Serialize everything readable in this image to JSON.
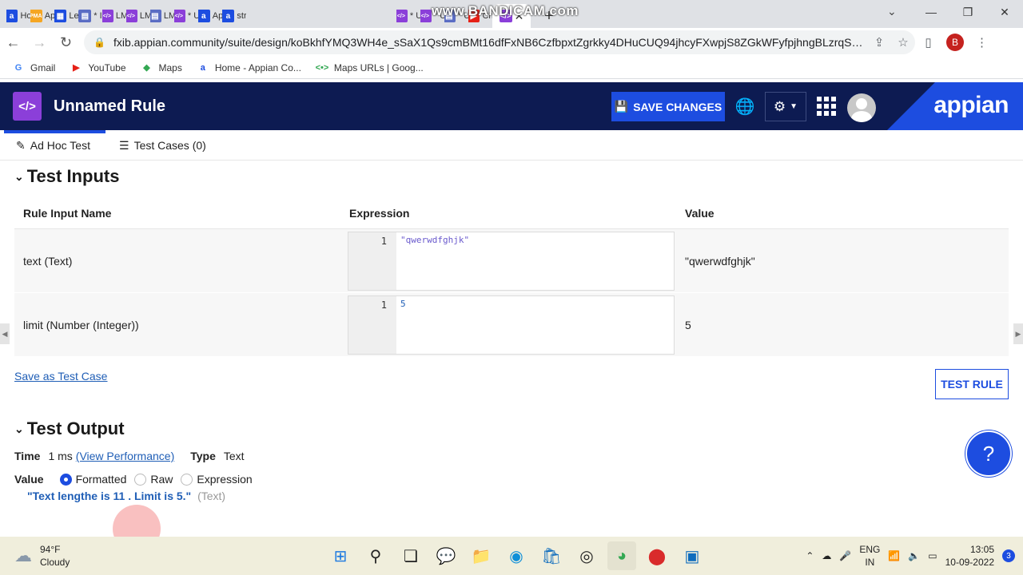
{
  "browser": {
    "tabs": [
      {
        "title": "Ho",
        "fav_bg": "#1d4de0",
        "fav": "a"
      },
      {
        "title": "Ap",
        "fav_bg": "#f5a623",
        "fav": "PMA"
      },
      {
        "title": "Le",
        "fav_bg": "#1d4de0",
        "fav": "▦"
      },
      {
        "title": "* I",
        "fav_bg": "#5b6dc4",
        "fav": "▤"
      },
      {
        "title": "LM",
        "fav_bg": "#8b3fd9",
        "fav": "</>"
      },
      {
        "title": "LM",
        "fav_bg": "#8b3fd9",
        "fav": "</>"
      },
      {
        "title": "LM",
        "fav_bg": "#5b6dc4",
        "fav": "▤"
      },
      {
        "title": "* U",
        "fav_bg": "#8b3fd9",
        "fav": "</>"
      },
      {
        "title": "Ap",
        "fav_bg": "#1d4de0",
        "fav": "a"
      },
      {
        "title": "str",
        "fav_bg": "#1d4de0",
        "fav": "a"
      }
    ],
    "tabs_after": [
      {
        "title": "* U",
        "fav_bg": "#8b3fd9",
        "fav": "</>"
      },
      {
        "title": "* U",
        "fav_bg": "#8b3fd9",
        "fav": "</>"
      },
      {
        "title": "* U",
        "fav_bg": "#5b6dc4",
        "fav": "▤"
      },
      {
        "title": "Ch",
        "fav_bg": "#e62117",
        "fav": "▶"
      }
    ],
    "watermark": "www.BANDICAM.com",
    "url": "fxib.appian.community/suite/design/koBkhfYMQ3WH4e_sSaX1Qs9cmBMt16dfFxNB6CzfbpxtZgrkky4DHuCUQ94jhcyFXwpjS8ZGkWFyfpjhngBLzrqSnRwtfrY...",
    "profile_initial": "B",
    "bookmarks": [
      {
        "label": "Gmail",
        "icon": "G",
        "color": "#4285f4"
      },
      {
        "label": "YouTube",
        "icon": "▶",
        "color": "#e62117"
      },
      {
        "label": "Maps",
        "icon": "◆",
        "color": "#34a853"
      },
      {
        "label": "Home - Appian Co...",
        "icon": "a",
        "color": "#1d4de0"
      },
      {
        "label": "Maps URLs  |  Goog...",
        "icon": "<•>",
        "color": "#34a853"
      }
    ]
  },
  "app": {
    "logo": "</>",
    "title": "Unnamed Rule",
    "save_label": "SAVE CHANGES",
    "brand": "appian"
  },
  "subtabs": {
    "adhoc": "Ad Hoc Test",
    "cases": "Test Cases (0)"
  },
  "inputs": {
    "title": "Test Inputs",
    "headers": [
      "Rule Input Name",
      "Expression",
      "Value"
    ],
    "rows": [
      {
        "name": "text (Text)",
        "line": "1",
        "expression": "\"qwerwdfghjk\"",
        "value": "\"qwerwdfghjk\""
      },
      {
        "name": "limit (Number (Integer))",
        "line": "1",
        "expression": "5",
        "value": "5"
      }
    ],
    "save_case": "Save as Test Case",
    "test_rule": "TEST RULE"
  },
  "output": {
    "title": "Test Output",
    "time_label": "Time",
    "time_value": "1 ms",
    "perf_link": "(View Performance)",
    "type_label": "Type",
    "type_value": "Text",
    "value_label": "Value",
    "options": [
      "Formatted",
      "Raw",
      "Expression"
    ],
    "selected": "Formatted",
    "result": "\"Text lengthe is 11 . Limit is 5.\"",
    "result_type": "(Text)"
  },
  "taskbar": {
    "temp": "94°F",
    "weather": "Cloudy",
    "lang1": "ENG",
    "lang2": "IN",
    "time": "13:05",
    "date": "10-09-2022",
    "notifications": "3"
  },
  "colors": {
    "header_bg": "#0d1b52",
    "accent": "#1d4de0",
    "logo_purple": "#8b3fd9"
  }
}
